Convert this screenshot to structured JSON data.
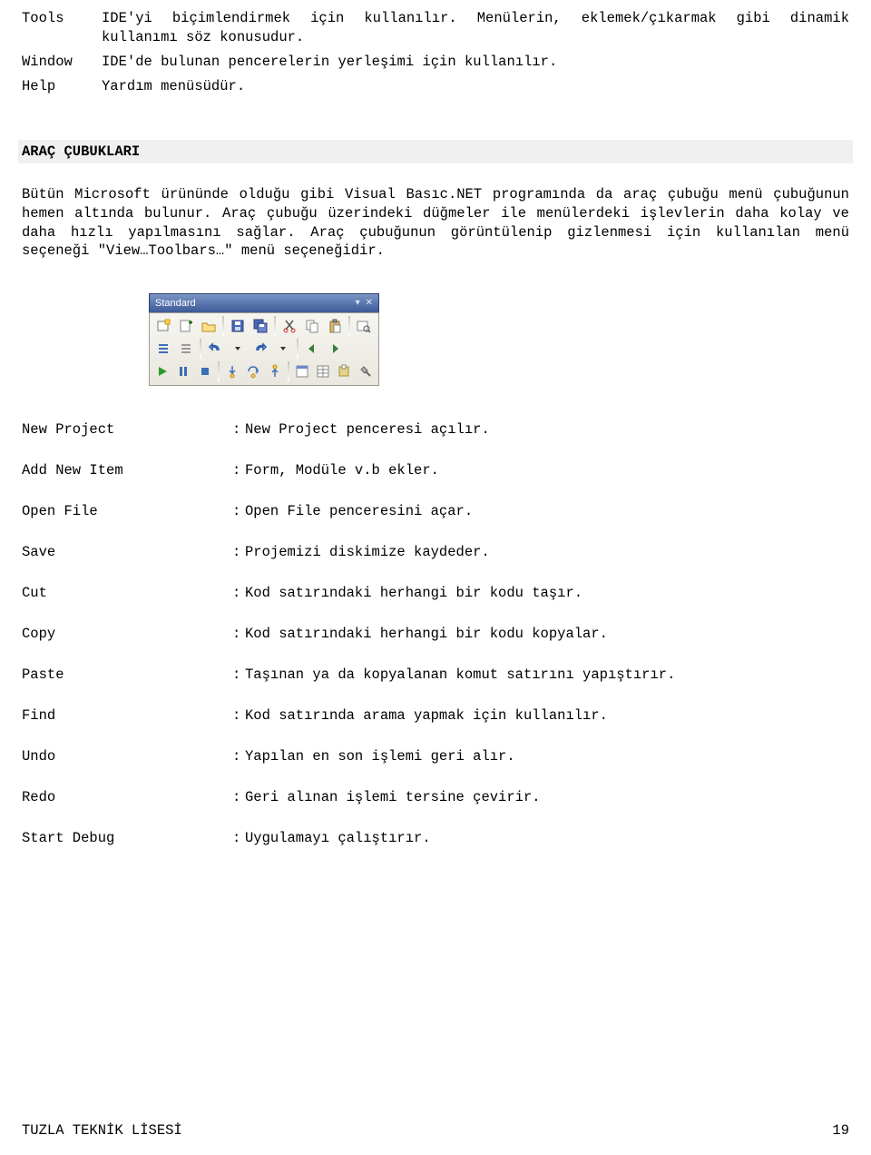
{
  "menus": {
    "tools": {
      "label": "Tools",
      "desc": "IDE'yi biçimlendirmek için kullanılır. Menülerin, eklemek/çıkarmak gibi dinamik kullanımı söz konusudur."
    },
    "window": {
      "label": "Window",
      "desc": "IDE'de bulunan pencerelerin yerleşimi için kullanılır."
    },
    "help": {
      "label": "Help",
      "desc": "Yardım menüsüdür."
    }
  },
  "section": {
    "title": "ARAÇ ÇUBUKLARI"
  },
  "paragraph": "Bütün Microsoft ürününde olduğu gibi Visual Basıc.NET programında da araç çubuğu menü çubuğunun hemen altında bulunur. Araç çubuğu üzerindeki düğmeler ile menülerdeki işlevlerin daha kolay ve daha hızlı yapılmasını sağlar. Araç çubuğunun görüntülenip gizlenmesi için kullanılan menü seçeneği \"View…Toolbars…\" menü seçeneğidir.",
  "toolbar": {
    "title": "Standard"
  },
  "defs": [
    {
      "label": "New Project",
      "desc": "New Project penceresi açılır."
    },
    {
      "label": "Add New Item",
      "desc": "Form, Modüle v.b ekler."
    },
    {
      "label": "Open File",
      "desc": "Open File penceresini açar."
    },
    {
      "label": "Save",
      "desc": "Projemizi diskimize kaydeder."
    },
    {
      "label": "Cut",
      "desc": "Kod satırındaki herhangi bir kodu taşır."
    },
    {
      "label": "Copy",
      "desc": "Kod satırındaki herhangi bir kodu kopyalar."
    },
    {
      "label": "Paste",
      "desc": "Taşınan ya da kopyalanan komut satırını yapıştırır."
    },
    {
      "label": "Find",
      "desc": "Kod satırında arama yapmak için kullanılır."
    },
    {
      "label": "Undo",
      "desc": "Yapılan en son işlemi geri alır."
    },
    {
      "label": "Redo",
      "desc": "Geri alınan işlemi tersine çevirir."
    },
    {
      "label": "Start Debug",
      "desc": "Uygulamayı çalıştırır."
    }
  ],
  "footer": {
    "left": "TUZLA TEKNİK LİSESİ",
    "right": "19"
  },
  "colon": ":",
  "colon_nbsp": ": "
}
